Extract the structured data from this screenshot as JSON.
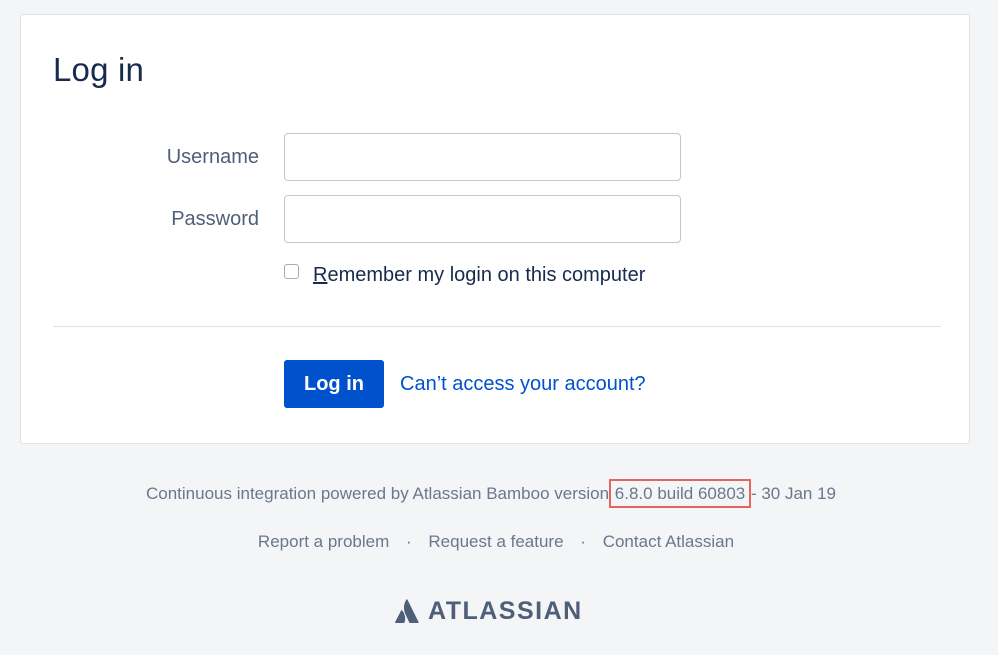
{
  "page": {
    "title": "Log in"
  },
  "form": {
    "username_label": "Username",
    "username_value": "",
    "password_label": "Password",
    "password_value": "",
    "remember": {
      "accesskey_letter": "R",
      "rest": "emember my login on this computer",
      "checked": false
    },
    "login_button": "Log in",
    "forgot_link": "Can’t access your account?"
  },
  "footer": {
    "powered_prefix": "Continuous integration powered by Atlassian Bamboo version ",
    "version_build": "6.8.0 build 60803",
    "powered_suffix": " - 30 Jan 19",
    "links": [
      "Report a problem",
      "Request a feature",
      "Contact Atlassian"
    ],
    "separator": "·",
    "logo_text": "ATLASSIAN"
  },
  "colors": {
    "primary": "#0052cc",
    "background": "#f4f5f7",
    "text": "#172b4d",
    "muted": "#6b778c",
    "highlight_box": "#e6645b"
  },
  "icons": {
    "logo": "atlassian-logo-icon"
  }
}
